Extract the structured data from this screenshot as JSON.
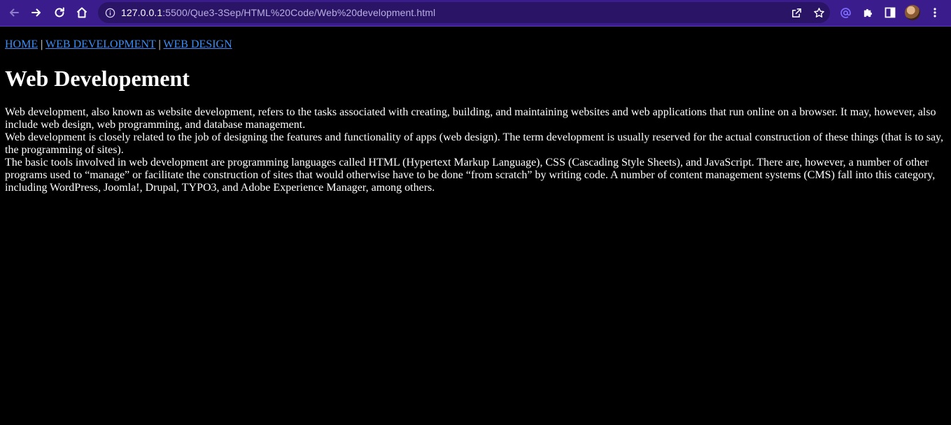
{
  "browser": {
    "url_host": "127.0.0.1",
    "url_path": ":5500/Que3-3Sep/HTML%20Code/Web%20development.html",
    "colors": {
      "toolbar": "#3b1c8c",
      "omnibox": "#2a1466",
      "link": "#3a8ef6"
    },
    "icons": [
      "back-arrow-icon",
      "forward-arrow-icon",
      "reload-icon",
      "home-icon",
      "info-icon",
      "share-icon",
      "star-icon",
      "extension-at-icon",
      "puzzle-icon",
      "side-panel-icon",
      "avatar",
      "kebab-menu-icon"
    ]
  },
  "nav": {
    "home": "HOME",
    "sep1": " | ",
    "web_development": "WEB DEVELOPMENT",
    "sep2": " | ",
    "web_design": "WEB DESIGN"
  },
  "heading": "Web Developement",
  "paragraphs": [
    "Web development, also known as website development, refers to the tasks associated with creating, building, and maintaining websites and web applications that run online on a browser. It may, however, also include web design, web programming, and database management.",
    "Web development is closely related to the job of designing the features and functionality of apps (web design). The term development is usually reserved for the actual construction of these things (that is to say, the programming of sites).",
    "The basic tools involved in web development are programming languages called HTML (Hypertext Markup Language), CSS (Cascading Style Sheets), and JavaScript. There are, however, a number of other programs used to “manage” or facilitate the construction of sites that would otherwise have to be done “from scratch” by writing code. A number of content management systems (CMS) fall into this category, including WordPress, Joomla!, Drupal, TYPO3, and Adobe Experience Manager, among others."
  ]
}
